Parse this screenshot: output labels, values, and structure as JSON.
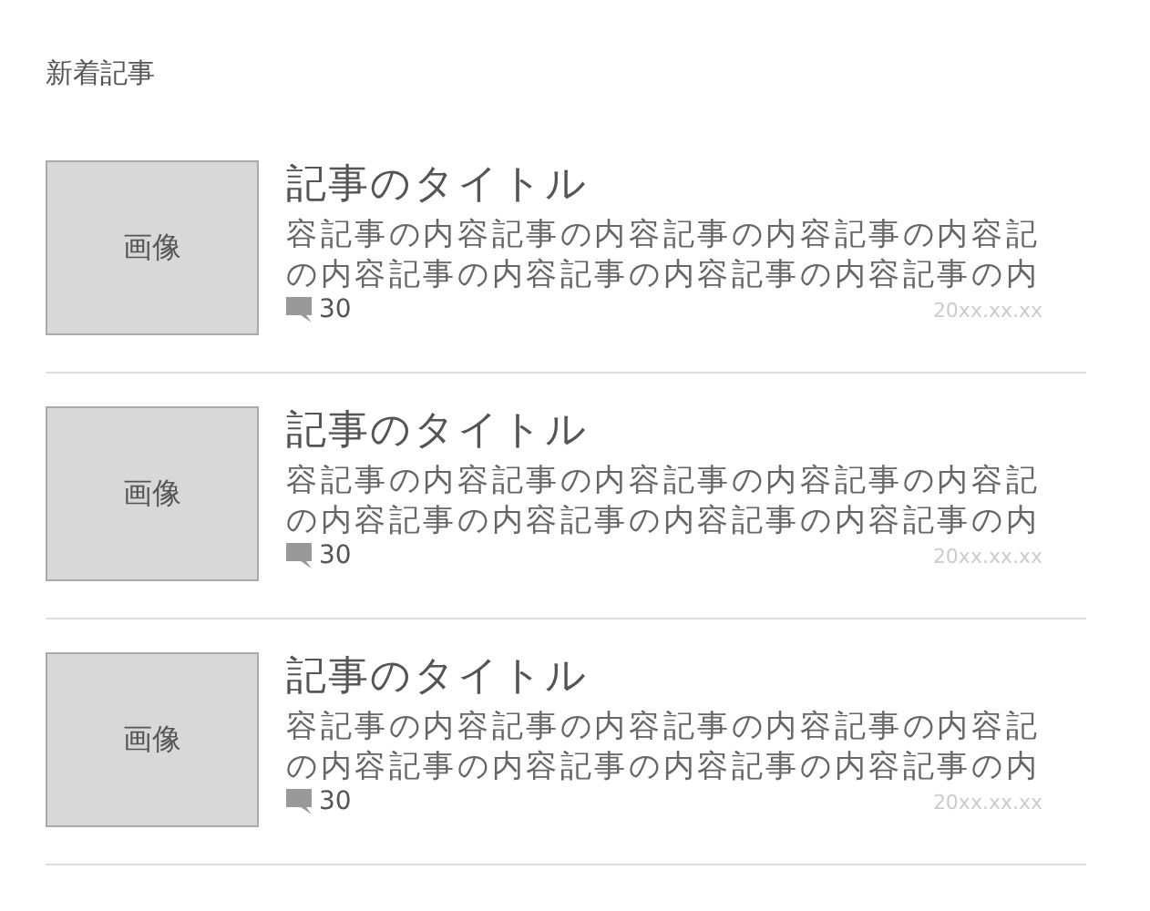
{
  "heading": "新着記事",
  "articles": [
    {
      "image_label": "画像",
      "title": "記事のタイトル",
      "excerpt": "容記事の内容記事の内容記事の内容記事の内容記の内容記事の内容記事の内容記事の内容記事の内",
      "comments": "30",
      "date": "20xx.xx.xx"
    },
    {
      "image_label": "画像",
      "title": "記事のタイトル",
      "excerpt": "容記事の内容記事の内容記事の内容記事の内容記の内容記事の内容記事の内容記事の内容記事の内",
      "comments": "30",
      "date": "20xx.xx.xx"
    },
    {
      "image_label": "画像",
      "title": "記事のタイトル",
      "excerpt": "容記事の内容記事の内容記事の内容記事の内容記の内容記事の内容記事の内容記事の内容記事の内",
      "comments": "30",
      "date": "20xx.xx.xx"
    }
  ]
}
